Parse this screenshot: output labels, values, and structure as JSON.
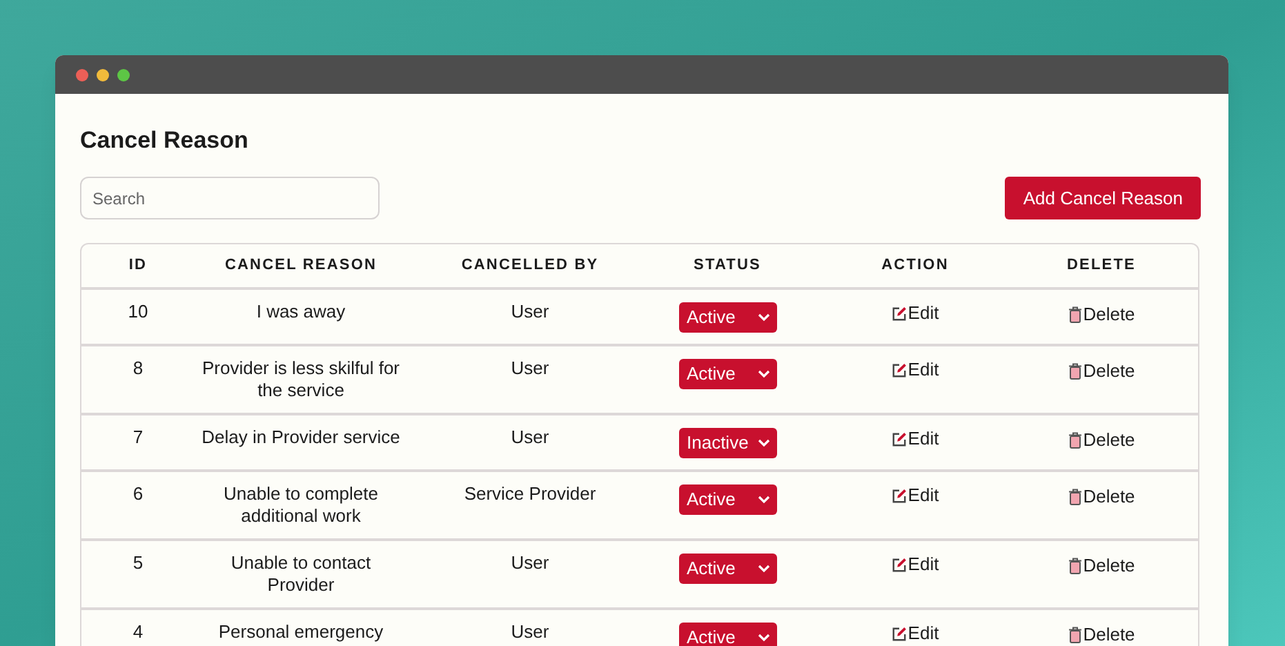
{
  "page": {
    "title": "Cancel Reason"
  },
  "search": {
    "placeholder": "Search"
  },
  "add_button": "Add Cancel Reason",
  "table": {
    "columns": [
      "ID",
      "CANCEL REASON",
      "CANCELLED BY",
      "STATUS",
      "ACTION",
      "DELETE"
    ],
    "rows": [
      {
        "id": "10",
        "reason": "I was away",
        "cancelled_by": "User",
        "status": "Active",
        "action": "Edit",
        "delete": "Delete"
      },
      {
        "id": "8",
        "reason": "Provider is less skilful for the service",
        "cancelled_by": "User",
        "status": "Active",
        "action": "Edit",
        "delete": "Delete"
      },
      {
        "id": "7",
        "reason": "Delay in Provider service",
        "cancelled_by": "User",
        "status": "Inactive",
        "action": "Edit",
        "delete": "Delete"
      },
      {
        "id": "6",
        "reason": "Unable to complete additional work",
        "cancelled_by": "Service Provider",
        "status": "Active",
        "action": "Edit",
        "delete": "Delete"
      },
      {
        "id": "5",
        "reason": "Unable to contact Provider",
        "cancelled_by": "User",
        "status": "Active",
        "action": "Edit",
        "delete": "Delete"
      },
      {
        "id": "4",
        "reason": "Personal emergency",
        "cancelled_by": "User",
        "status": "Active",
        "action": "Edit",
        "delete": "Delete"
      }
    ]
  }
}
